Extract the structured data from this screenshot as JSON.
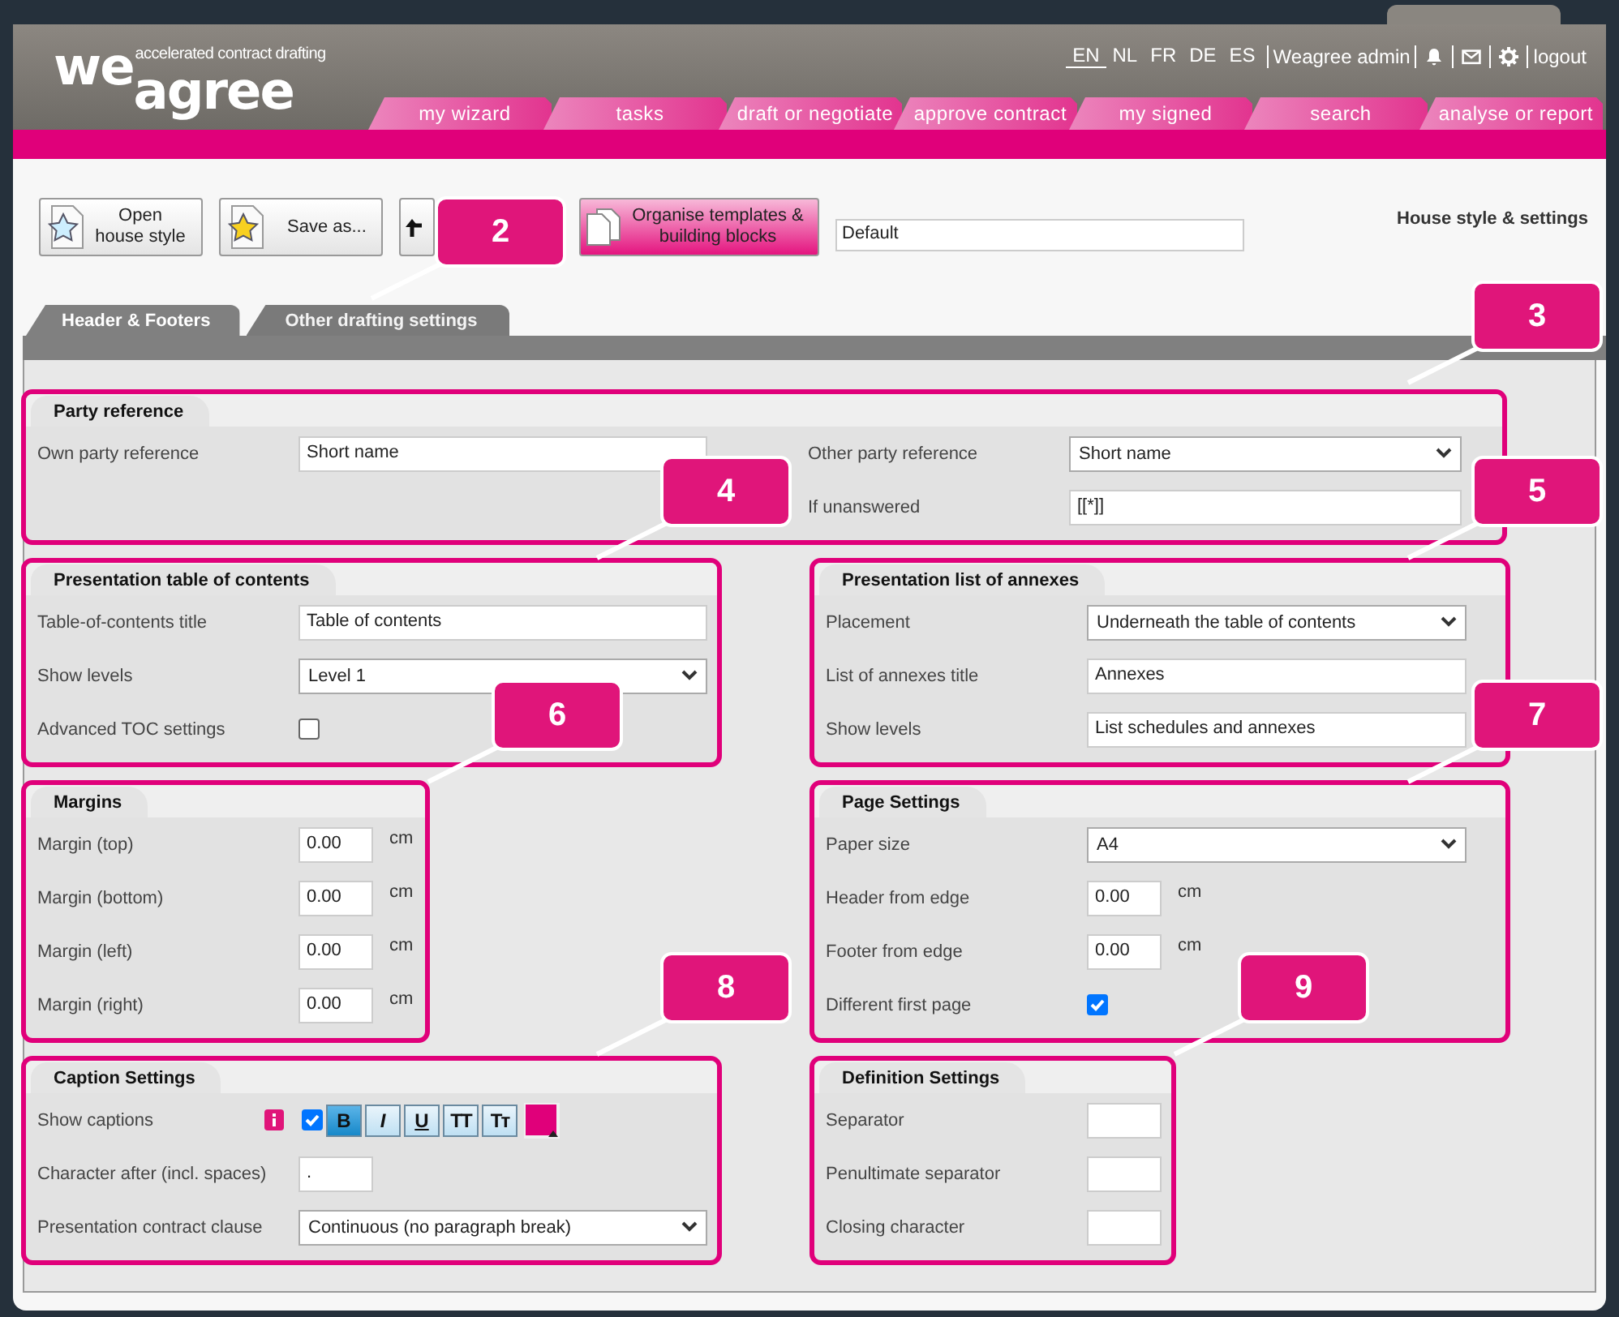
{
  "header": {
    "logo_top": "we",
    "logo_bottom": "agree",
    "tagline": "accelerated contract drafting",
    "languages": [
      {
        "label": "EN",
        "selected": true
      },
      {
        "label": "NL",
        "selected": false
      },
      {
        "label": "FR",
        "selected": false
      },
      {
        "label": "DE",
        "selected": false
      },
      {
        "label": "ES",
        "selected": false
      }
    ],
    "user": "Weagree admin",
    "logout": "logout",
    "nav": [
      "my wizard",
      "tasks",
      "draft or negotiate",
      "approve contract",
      "my signed",
      "search",
      "analyse or report"
    ]
  },
  "toolbar": {
    "open_button": "Open house style",
    "save_button": "Save as...",
    "organise_button": "Organise templates & building blocks",
    "style_name": "Default",
    "page_title": "House style & settings"
  },
  "tabs": [
    {
      "label": "Header & Footers",
      "selected": false
    },
    {
      "label": "Other drafting settings",
      "selected": true
    }
  ],
  "sections": [
    {
      "title": "Party reference",
      "columns": [
        [
          {
            "label": "Own party reference",
            "kind": "text",
            "value": "Short name"
          }
        ],
        [
          {
            "label": "Other party reference",
            "kind": "select",
            "value": "Short name"
          },
          {
            "label": "If unanswered",
            "kind": "text",
            "value": "[[*]]"
          }
        ]
      ]
    },
    {
      "title": "Presentation table of contents",
      "fields": [
        {
          "label": "Table-of-contents title",
          "kind": "text",
          "value": "Table of contents"
        },
        {
          "label": "Show levels",
          "kind": "select",
          "value": "Level 1"
        },
        {
          "label": "Advanced TOC settings",
          "kind": "checkbox",
          "checked": false
        }
      ]
    },
    {
      "title": "Presentation list of annexes",
      "fields": [
        {
          "label": "Placement",
          "kind": "select",
          "value": "Underneath the table of contents"
        },
        {
          "label": "List of annexes title",
          "kind": "text",
          "value": "Annexes"
        },
        {
          "label": "Show levels",
          "kind": "text",
          "value": "List schedules and annexes"
        }
      ]
    },
    {
      "title": "Margins",
      "fields": [
        {
          "label": "Margin (top)",
          "kind": "number",
          "value": "0.00",
          "unit": "cm"
        },
        {
          "label": "Margin (bottom)",
          "kind": "number",
          "value": "0.00",
          "unit": "cm"
        },
        {
          "label": "Margin (left)",
          "kind": "number",
          "value": "0.00",
          "unit": "cm"
        },
        {
          "label": "Margin (right)",
          "kind": "number",
          "value": "0.00",
          "unit": "cm"
        }
      ]
    },
    {
      "title": "Page Settings",
      "fields": [
        {
          "label": "Paper size",
          "kind": "select",
          "value": "A4"
        },
        {
          "label": "Header from edge",
          "kind": "number",
          "value": "0.00",
          "unit": "cm"
        },
        {
          "label": "Footer from edge",
          "kind": "number",
          "value": "0.00",
          "unit": "cm"
        },
        {
          "label": "Different first page",
          "kind": "checkbox",
          "checked": true
        }
      ]
    },
    {
      "title": "Caption Settings",
      "fields": [
        {
          "label": "Show captions",
          "kind": "caption_format",
          "checked": true,
          "color": "#e0007a",
          "buttons": [
            {
              "label": "B",
              "kind": "bold",
              "selected": true
            },
            {
              "label": "I",
              "kind": "italic",
              "selected": false
            },
            {
              "label": "U",
              "kind": "underline",
              "selected": false
            },
            {
              "label": "TT",
              "kind": "caps",
              "selected": false
            },
            {
              "label": "Tᴛ",
              "kind": "smallcaps",
              "selected": false
            }
          ]
        },
        {
          "label": "Character after (incl. spaces)",
          "kind": "short",
          "value": "."
        },
        {
          "label": "Presentation contract clause",
          "kind": "select",
          "value": "Continuous (no paragraph break)"
        }
      ]
    },
    {
      "title": "Definition Settings",
      "fields": [
        {
          "label": "Separator",
          "kind": "short"
        },
        {
          "label": "Penultimate separator",
          "kind": "short"
        },
        {
          "label": "Closing character",
          "kind": "short"
        }
      ]
    }
  ],
  "callouts": [
    {
      "number": "2"
    },
    {
      "number": "3"
    },
    {
      "number": "4"
    },
    {
      "number": "5"
    },
    {
      "number": "6"
    },
    {
      "number": "7"
    },
    {
      "number": "8"
    },
    {
      "number": "9"
    }
  ]
}
